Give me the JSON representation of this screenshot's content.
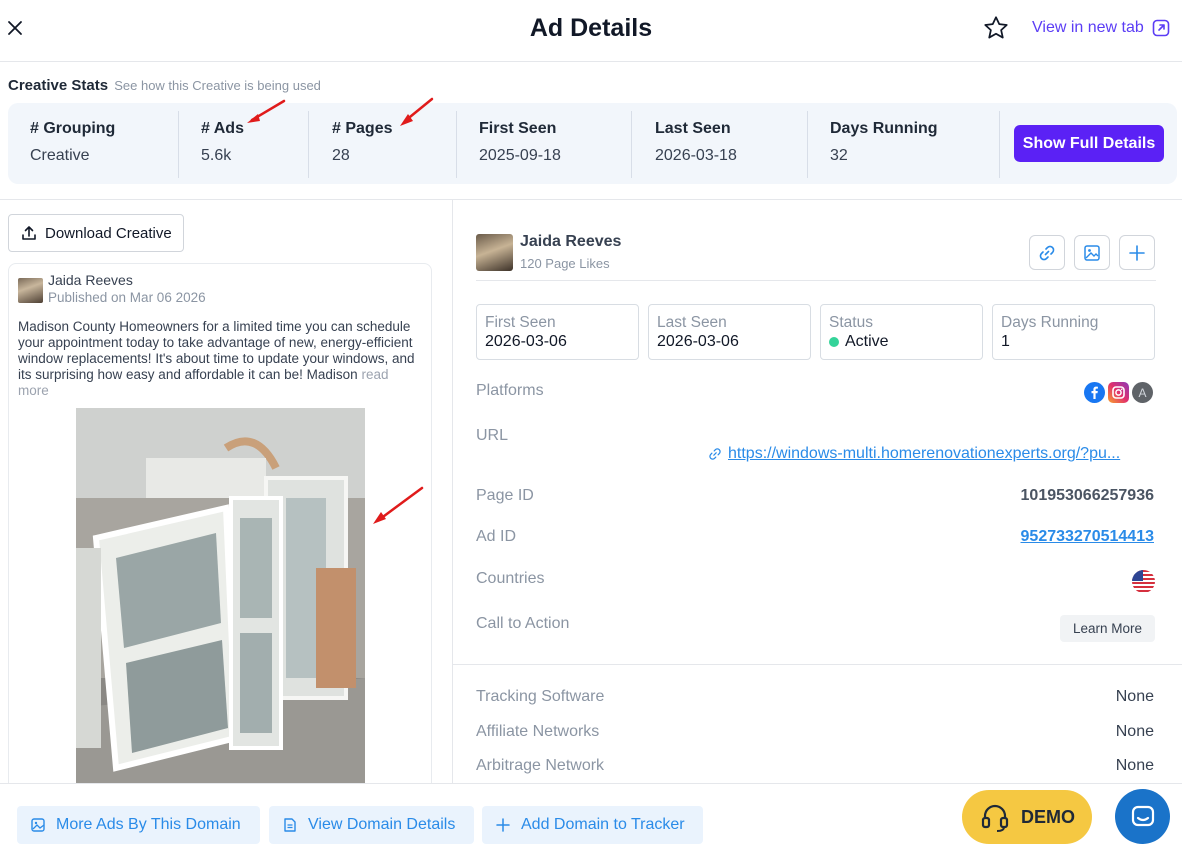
{
  "header": {
    "title": "Ad Details",
    "view_new_tab": "View in new tab",
    "accent_color": "#5b3df5"
  },
  "creative_stats": {
    "title": "Creative Stats",
    "subtitle": "See how this Creative is being used",
    "stats": [
      {
        "label": "# Grouping",
        "value": "Creative"
      },
      {
        "label": "# Ads",
        "value": "5.6k"
      },
      {
        "label": "# Pages",
        "value": "28"
      },
      {
        "label": "First Seen",
        "value": "2025-09-18"
      },
      {
        "label": "Last Seen",
        "value": "2026-03-18"
      },
      {
        "label": "Days Running",
        "value": "32"
      }
    ],
    "show_full_details": "Show Full Details"
  },
  "left": {
    "download_label": "Download Creative",
    "ad": {
      "author": "Jaida Reeves",
      "published": "Published on Mar 06 2026",
      "body": "Madison County Homeowners for a limited time you can schedule your appointment today to take advantage of new, energy-efficient window replacements! It's about time to update your windows, and its surprising how easy and affordable it can be! Madison",
      "read_more": "read more"
    }
  },
  "right": {
    "advertiser": {
      "name": "Jaida Reeves",
      "likes": "120 Page Likes"
    },
    "info_boxes": [
      {
        "label": "First Seen",
        "value": "2026-03-06"
      },
      {
        "label": "Last Seen",
        "value": "2026-03-06"
      },
      {
        "label": "Status",
        "value": "Active"
      },
      {
        "label": "Days Running",
        "value": "1"
      }
    ],
    "platforms_label": "Platforms",
    "platform_icons": [
      "facebook-icon",
      "instagram-icon",
      "audience-network-icon"
    ],
    "audience_letter": "A",
    "url_label": "URL",
    "url_value": "https://windows-multi.homerenovationexperts.org/?pu...",
    "page_id_label": "Page ID",
    "page_id_value": "101953066257936",
    "ad_id_label": "Ad ID",
    "ad_id_value": "952733270514413",
    "countries_label": "Countries",
    "country_icon": "us-flag-icon",
    "cta_label": "Call to Action",
    "cta_value": "Learn More",
    "tracking_label": "Tracking Software",
    "tracking_value": "None",
    "affiliate_label": "Affiliate Networks",
    "affiliate_value": "None",
    "arbitrage_label": "Arbitrage Network",
    "arbitrage_value": "None"
  },
  "bottom": {
    "more_ads": "More Ads By This Domain",
    "view_domain": "View Domain Details",
    "add_tracker": "Add Domain to Tracker",
    "demo": "DEMO"
  }
}
